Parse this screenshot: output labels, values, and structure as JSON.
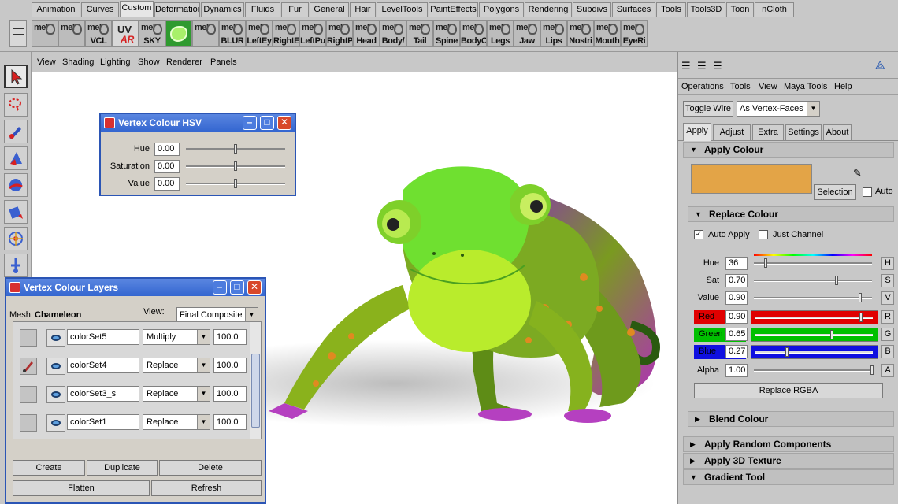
{
  "shelf_tabs": [
    "Animation",
    "Curves",
    "Custom",
    "Deformation",
    "Dynamics",
    "Fluids",
    "Fur",
    "General",
    "Hair",
    "LevelTools",
    "PaintEffects",
    "Polygons",
    "Rendering",
    "Subdivs",
    "Surfaces",
    "Tools",
    "Tools3D",
    "Toon",
    "nCloth"
  ],
  "active_shelf_tab": "Custom",
  "shelf_buttons": [
    {
      "mel": "mel",
      "label": ""
    },
    {
      "mel": "mel",
      "label": ""
    },
    {
      "mel": "mel",
      "label": "VCL"
    },
    {
      "special": "uv",
      "uv": "UV",
      "ar": "AR",
      "label": ""
    },
    {
      "mel": "mel",
      "label": "SKY"
    },
    {
      "special": "green",
      "label": ""
    },
    {
      "mel": "mel",
      "label": ""
    },
    {
      "mel": "mel",
      "label": "BLUR"
    },
    {
      "mel": "mel",
      "label": "LeftEy"
    },
    {
      "mel": "mel",
      "label": "RightE"
    },
    {
      "mel": "mel",
      "label": "LeftPu"
    },
    {
      "mel": "mel",
      "label": "RightP"
    },
    {
      "mel": "mel",
      "label": "Head"
    },
    {
      "mel": "mel",
      "label": "Body/"
    },
    {
      "mel": "mel",
      "label": "Tail"
    },
    {
      "mel": "mel",
      "label": "Spine"
    },
    {
      "mel": "mel",
      "label": "BodyC"
    },
    {
      "mel": "mel",
      "label": "Legs"
    },
    {
      "mel": "mel",
      "label": "Jaw"
    },
    {
      "mel": "mel",
      "label": "Lips"
    },
    {
      "mel": "mel",
      "label": "Nostri"
    },
    {
      "mel": "mel",
      "label": "Mouth"
    },
    {
      "mel": "mel",
      "label": "EyeRi"
    }
  ],
  "panel_menu": [
    "View",
    "Shading",
    "Lighting",
    "Show",
    "Renderer",
    "Panels"
  ],
  "hsv_window": {
    "title": "Vertex Colour HSV",
    "rows": [
      {
        "label": "Hue",
        "value": "0.00",
        "pos": 0.5
      },
      {
        "label": "Saturation",
        "value": "0.00",
        "pos": 0.5
      },
      {
        "label": "Value",
        "value": "0.00",
        "pos": 0.5
      }
    ]
  },
  "layers_window": {
    "title": "Vertex Colour Layers",
    "mesh_label": "Mesh:",
    "mesh_name": "Chameleon",
    "view_label": "View:",
    "view_value": "Final Composite",
    "layers": [
      {
        "name": "colorSet5",
        "blend": "Multiply",
        "opacity": "100.0",
        "brush": false
      },
      {
        "name": "colorSet4",
        "blend": "Replace",
        "opacity": "100.0",
        "brush": true
      },
      {
        "name": "colorSet3_s",
        "blend": "Replace",
        "opacity": "100.0",
        "brush": false
      },
      {
        "name": "colorSet1",
        "blend": "Replace",
        "opacity": "100.0",
        "brush": false
      }
    ],
    "buttons": {
      "create": "Create",
      "duplicate": "Duplicate",
      "delete": "Delete",
      "flatten": "Flatten",
      "refresh": "Refresh"
    }
  },
  "right_panel": {
    "menu": [
      "Operations",
      "Tools",
      "View",
      "Maya Tools",
      "Help"
    ],
    "toggle_label": "Toggle Wire",
    "as_mode": "As Vertex-Faces",
    "tabs": [
      "Apply",
      "Adjust",
      "Extra",
      "Settings",
      "About"
    ],
    "active_tab": "Apply",
    "apply_colour_header": "Apply Colour",
    "swatch_color": "#E3A447",
    "selection_label": "Selection",
    "auto_label": "Auto",
    "replace_colour_header": "Replace Colour",
    "auto_apply_label": "Auto Apply",
    "auto_apply_checked": true,
    "just_channel_label": "Just Channel",
    "just_channel_checked": false,
    "hue": {
      "label": "Hue",
      "value": "36",
      "btn": "H",
      "pos": 0.1
    },
    "sat": {
      "label": "Sat",
      "value": "0.70",
      "btn": "S",
      "pos": 0.7
    },
    "val": {
      "label": "Value",
      "value": "0.90",
      "btn": "V",
      "pos": 0.9
    },
    "red": {
      "label": "Red",
      "value": "0.90",
      "btn": "R",
      "pos": 0.9,
      "color": "#E00000"
    },
    "green": {
      "label": "Green",
      "value": "0.65",
      "btn": "G",
      "pos": 0.65,
      "color": "#00C000"
    },
    "blue": {
      "label": "Blue",
      "value": "0.27",
      "btn": "B",
      "pos": 0.27,
      "color": "#1010E0"
    },
    "alpha": {
      "label": "Alpha",
      "value": "1.00",
      "btn": "A",
      "pos": 1.0
    },
    "replace_rgba": "Replace RGBA",
    "blend_colour_header": "Blend Colour",
    "random_header": "Apply Random Components",
    "texture_header": "Apply 3D Texture",
    "gradient_header": "Gradient Tool"
  }
}
